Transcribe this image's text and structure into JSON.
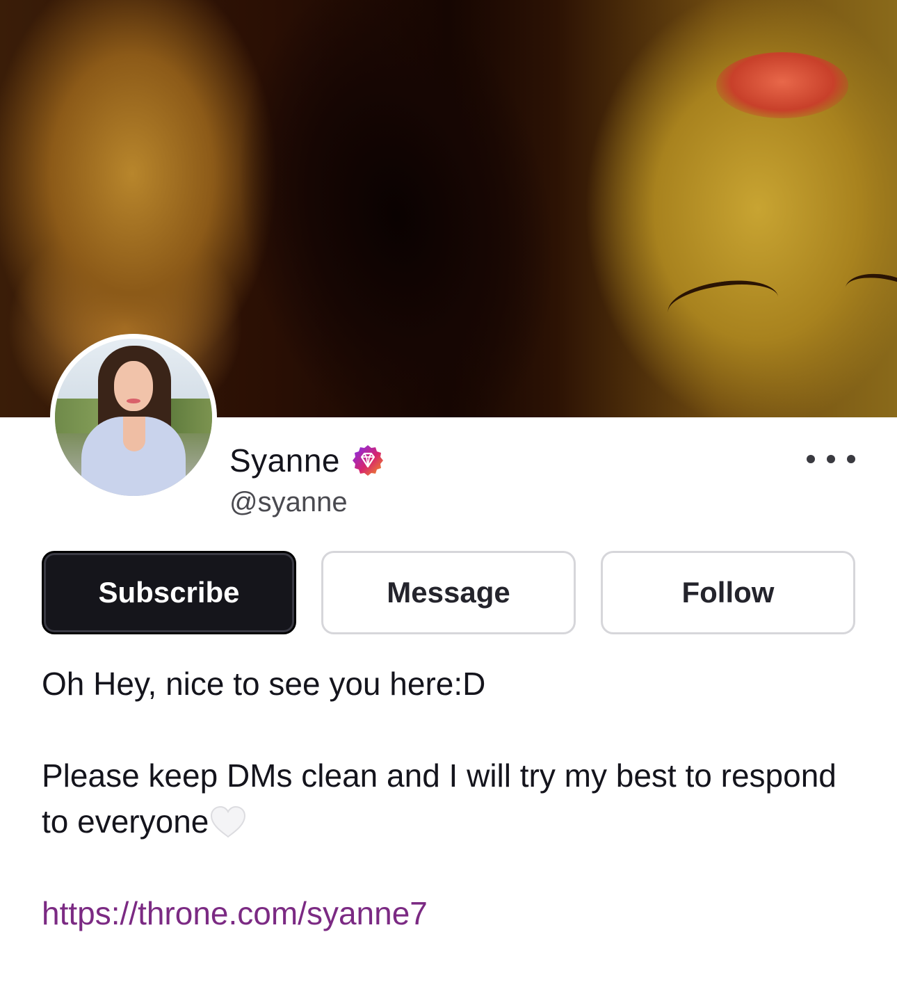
{
  "profile": {
    "display_name": "Syanne",
    "handle": "@syanne",
    "badge_icon": "gem-badge-icon",
    "badge_colors": [
      "#7b2ff7",
      "#d6246e",
      "#f39a1e"
    ]
  },
  "header": {
    "banner_image": "banner-photo",
    "more_icon": "more-horizontal-icon"
  },
  "actions": {
    "subscribe_label": "Subscribe",
    "message_label": "Message",
    "follow_label": "Follow"
  },
  "bio": {
    "line1": "Oh Hey, nice to see you here:D",
    "line2": "Please keep DMs clean and I will try my best to respond to everyone",
    "line2_emoji": "white-heart-icon",
    "link": "https://throne.com/syanne7"
  },
  "colors": {
    "primary_button": "#15151b",
    "link": "#7b2a83",
    "text": "#14141c",
    "muted_text": "#4a4a50",
    "outline": "#d6d6da"
  }
}
